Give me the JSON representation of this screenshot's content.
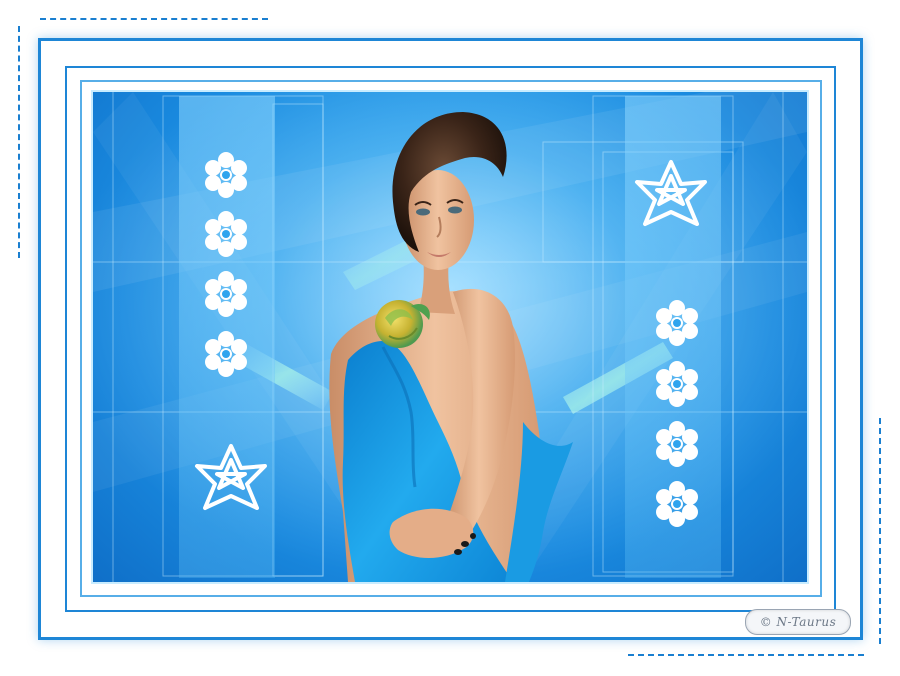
{
  "watermark": {
    "text": "© N-Taurus"
  },
  "colors": {
    "frame_blue": "#1e86d6",
    "canvas_light": "#7dd1ff",
    "canvas_dark": "#0f6fc8",
    "accent_white": "#ffffff",
    "dress_blue": "#1aa3e6",
    "hair_brown": "#3a2418",
    "skin": "#e8b48f",
    "rose_yellow": "#d8c23a",
    "rose_green": "#5fae5a"
  },
  "decor": {
    "left_column_icons": [
      "flower-icon",
      "flower-icon",
      "flower-icon",
      "flower-icon",
      "star-outline-icon"
    ],
    "right_column_icons": [
      "star-outline-icon",
      "flower-icon",
      "flower-icon",
      "flower-icon",
      "flower-icon"
    ]
  }
}
